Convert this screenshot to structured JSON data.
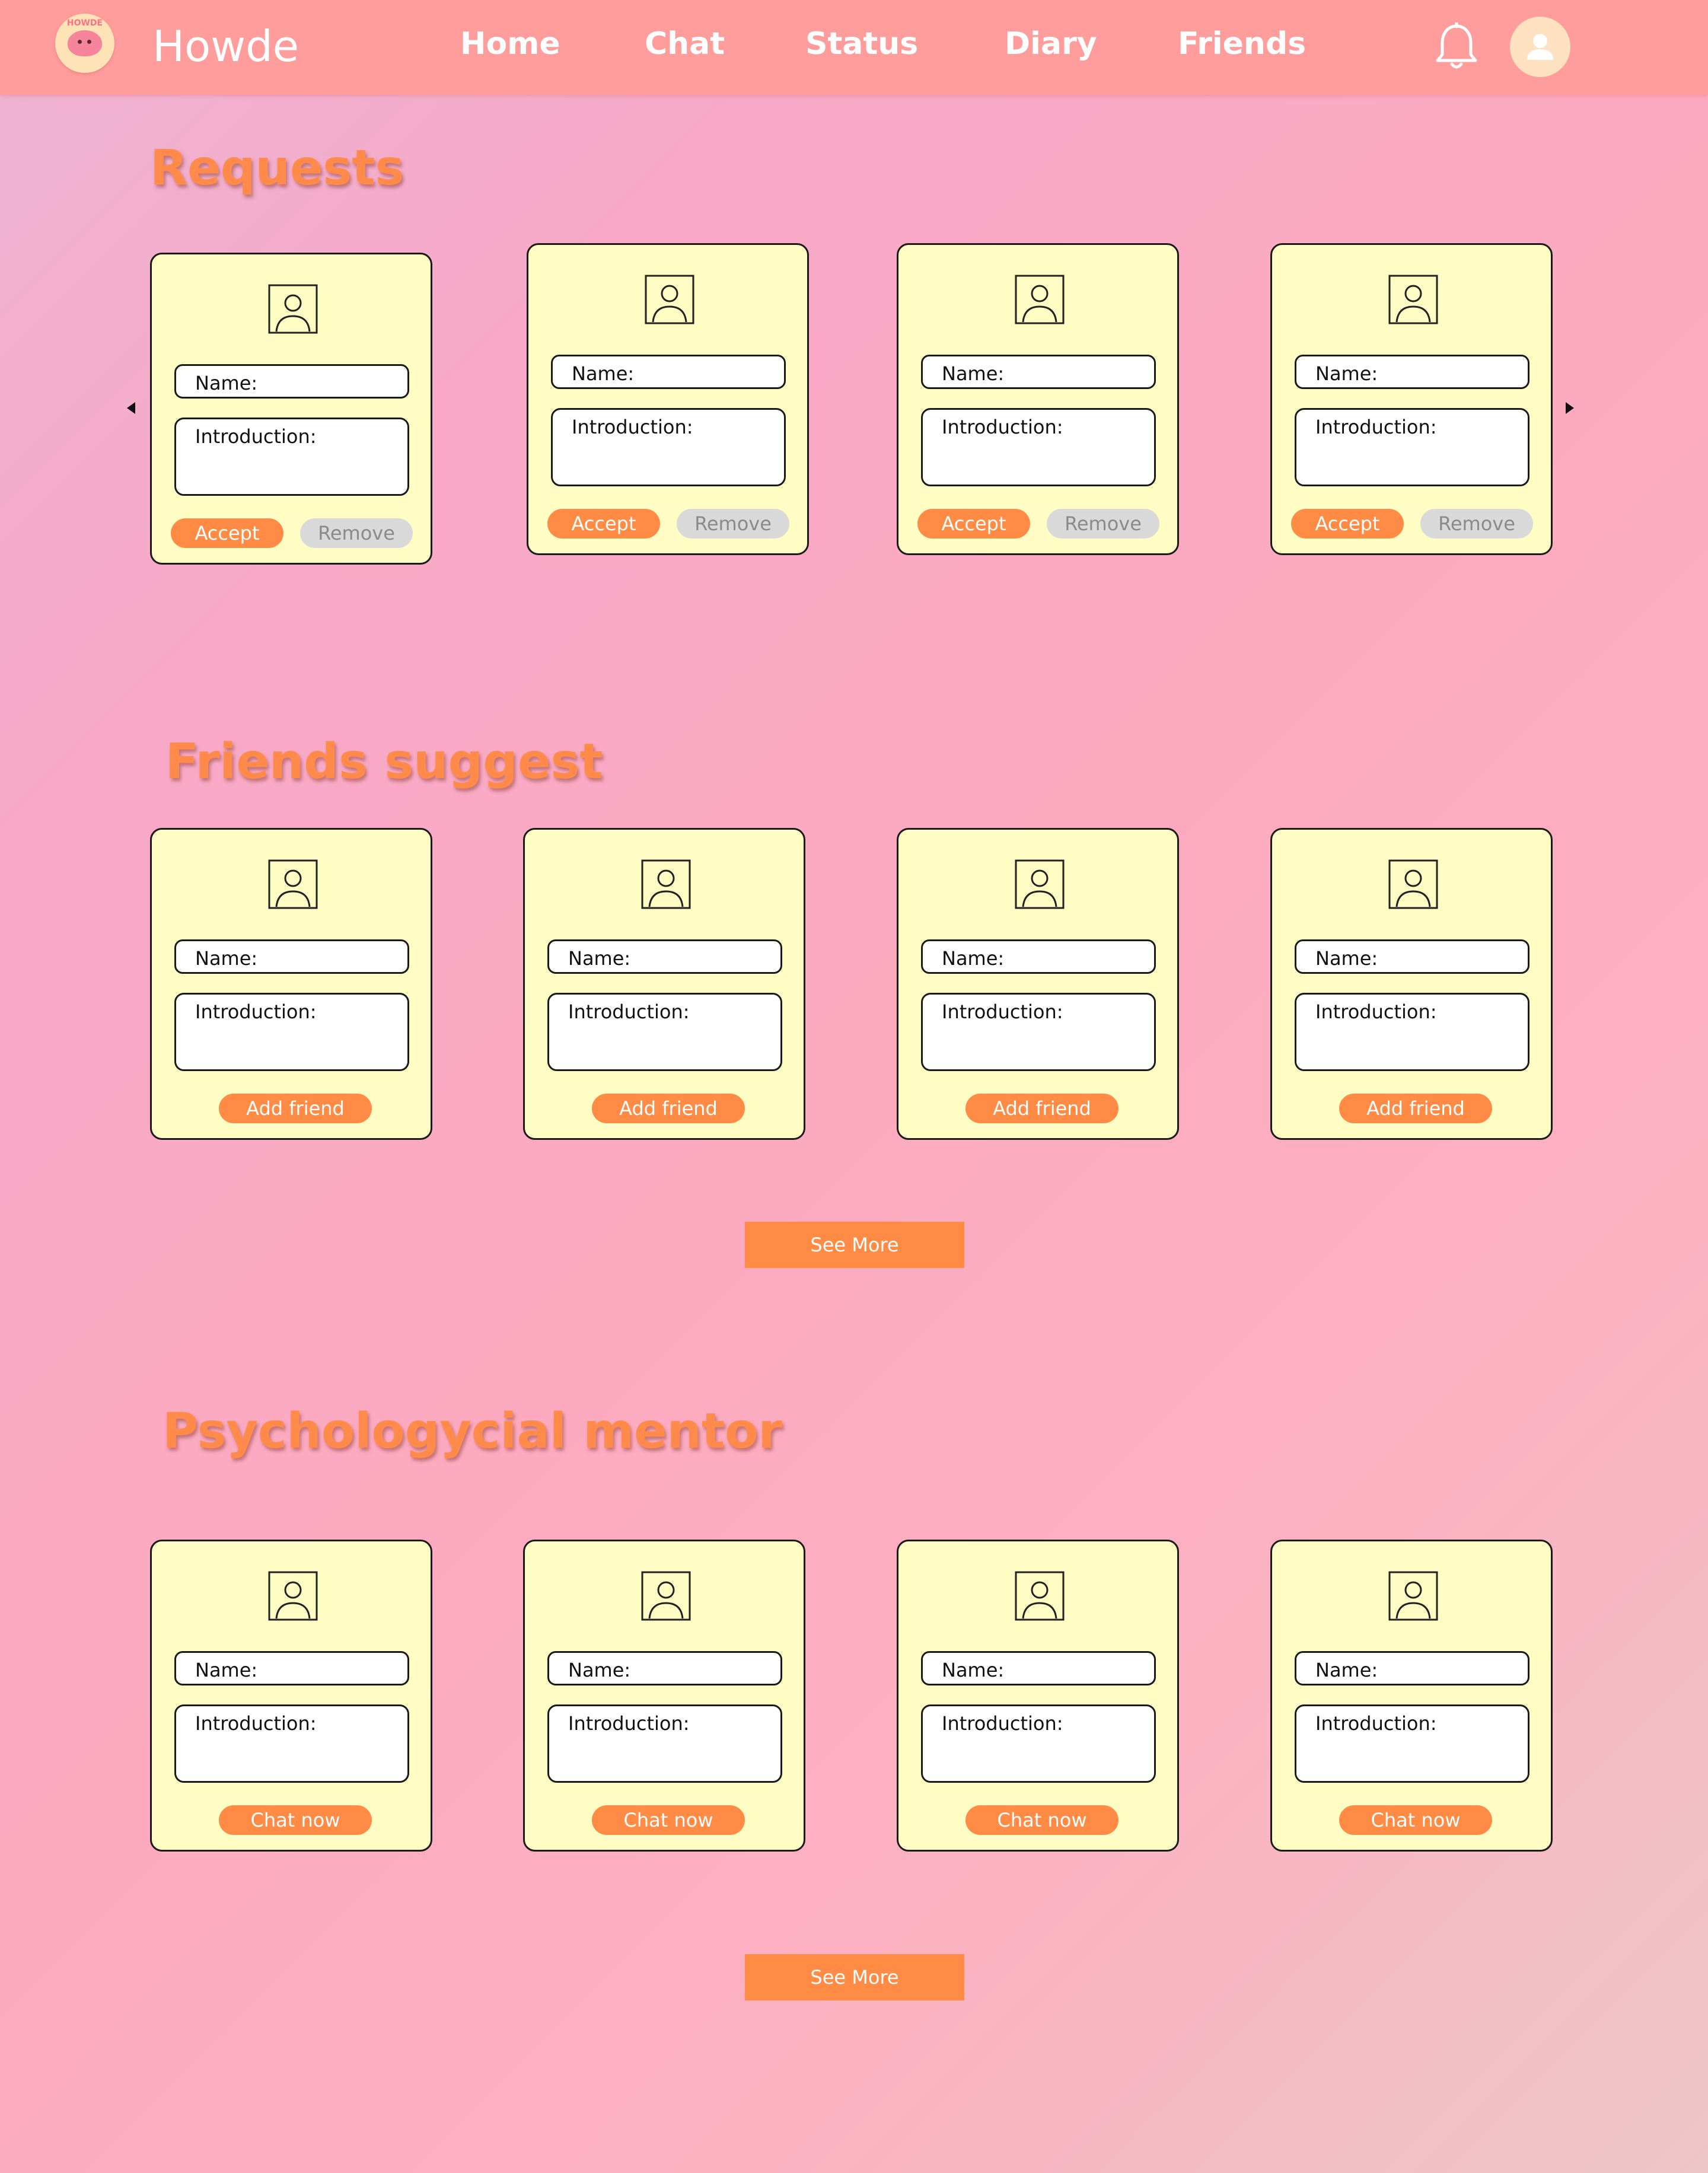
{
  "header": {
    "app_name": "Howde",
    "logo_text": "HOWDE",
    "nav": [
      "Home",
      "Chat",
      "Status",
      "Diary",
      "Friends"
    ]
  },
  "labels": {
    "name": "Name:",
    "introduction": "Introduction:"
  },
  "requests": {
    "title": "Requests",
    "accept_label": "Accept",
    "remove_label": "Remove"
  },
  "suggest": {
    "title": "Friends suggest",
    "button_label": "Add friend",
    "see_more": "See More"
  },
  "mentor": {
    "title": "Psychologycial mentor",
    "button_label": "Chat now",
    "see_more": "See More"
  },
  "colors": {
    "topbar": "#ff9c9c",
    "accent": "#ff8b45",
    "card": "#fffcc4",
    "disabled": "#d9d9d9"
  },
  "icons": [
    "bell-icon",
    "user-avatar-icon",
    "person-placeholder-icon",
    "arrow-left-icon",
    "arrow-right-icon"
  ]
}
